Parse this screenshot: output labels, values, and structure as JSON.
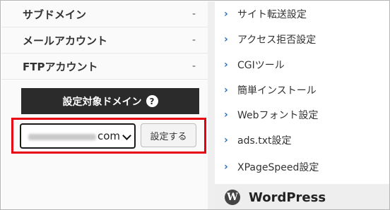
{
  "stats": [
    {
      "label": "サブドメイン",
      "value": "-"
    },
    {
      "label": "メールアカウント",
      "value": "-"
    },
    {
      "label": "FTPアカウント",
      "value": "-"
    }
  ],
  "domain_section": {
    "header": "設定対象ドメイン",
    "help_icon": "?",
    "select_value_suffix": "com",
    "set_button": "設定する",
    "highlight_color": "#e60012"
  },
  "menu": {
    "arrow": "›",
    "items": [
      {
        "label": "サイト転送設定"
      },
      {
        "label": "アクセス拒否設定"
      },
      {
        "label": "CGIツール"
      },
      {
        "label": "簡単インストール"
      },
      {
        "label": "Webフォント設定"
      },
      {
        "label": "ads.txt設定"
      },
      {
        "label": "XPageSpeed設定"
      }
    ]
  },
  "wordpress": {
    "icon": "W",
    "label": "WordPress"
  }
}
